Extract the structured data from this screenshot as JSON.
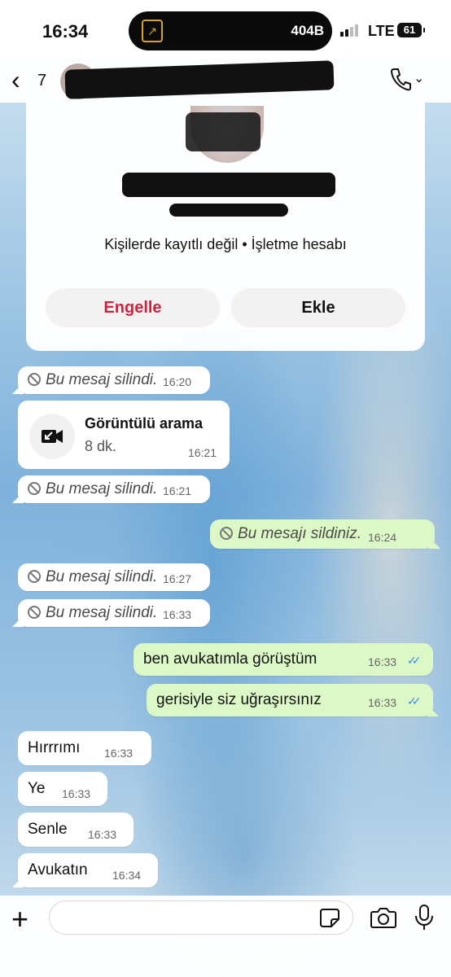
{
  "status_bar": {
    "time": "16:34",
    "data_rate": "404B",
    "network": "LTE",
    "battery": "61"
  },
  "header": {
    "back_count": "7",
    "icons": [
      "chevron-left-icon",
      "phone-icon",
      "chevron-down-icon"
    ]
  },
  "info_card": {
    "subtitle": "Kişilerde kayıtlı değil • İşletme hesabı",
    "block_label": "Engelle",
    "add_label": "Ekle"
  },
  "call": {
    "title": "Görüntülü arama",
    "duration": "8 dk.",
    "time": "16:21"
  },
  "messages": [
    {
      "dir": "in",
      "text": "Bu mesaj silindi.",
      "time": "16:20",
      "deleted": true
    },
    {
      "dir": "in",
      "text": "Bu mesaj silindi.",
      "time": "16:21",
      "deleted": true
    },
    {
      "dir": "out",
      "text": "Bu mesajı sildiniz.",
      "time": "16:24",
      "deleted": true
    },
    {
      "dir": "in",
      "text": "Bu mesaj silindi.",
      "time": "16:27",
      "deleted": true
    },
    {
      "dir": "in",
      "text": "Bu mesaj silindi.",
      "time": "16:33",
      "deleted": true
    },
    {
      "dir": "out",
      "text": "ben avukatımla görüştüm",
      "time": "16:33",
      "read": true
    },
    {
      "dir": "out",
      "text": "gerisiyle siz uğraşırsınız",
      "time": "16:33",
      "read": true
    },
    {
      "dir": "in",
      "text": "Hırrrımı",
      "time": "16:33"
    },
    {
      "dir": "in",
      "text": "Ye",
      "time": "16:33"
    },
    {
      "dir": "in",
      "text": "Senle",
      "time": "16:33"
    },
    {
      "dir": "in",
      "text": "Avukatın",
      "time": "16:34"
    }
  ],
  "colors": {
    "accent_red": "#d0223f",
    "outgoing_bubble": "#dcf8c6",
    "read_ticks": "#3a8ee6"
  }
}
